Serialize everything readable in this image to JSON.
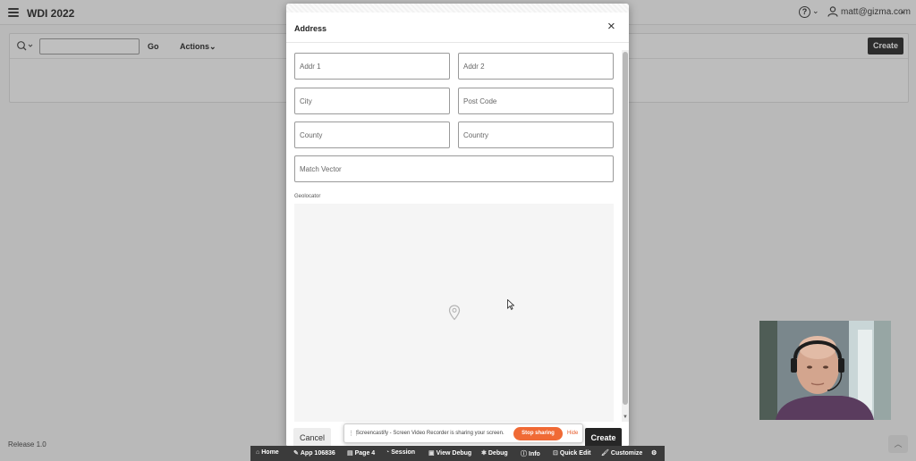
{
  "app": {
    "title": "WDI 2022",
    "user": "matt@gizma.com",
    "help_glyph": "?",
    "chevron_glyph": "⌄"
  },
  "toolbar": {
    "go_label": "Go",
    "actions_label": "Actions",
    "create_label": "Create"
  },
  "footer": {
    "release": "Release 1.0"
  },
  "dialog": {
    "title": "Address",
    "fields": {
      "addr1": "Addr 1",
      "addr2": "Addr 2",
      "city": "City",
      "post_code": "Post Code",
      "county": "County",
      "country": "Country",
      "match_vector": "Match Vector"
    },
    "geolocator_label": "Geolocator",
    "cancel_label": "Cancel",
    "create_label": "Create"
  },
  "share_bar": {
    "message": "Screencastify - Screen Video Recorder is sharing your screen.",
    "stop_label": "Stop sharing",
    "hide_label": "Hide"
  },
  "dev_toolbar": {
    "home": "Home",
    "app": "App 106836",
    "page": "Page 4",
    "session": "Session",
    "view_debug": "View Debug",
    "debug": "Debug",
    "info": "Info",
    "quick_edit": "Quick Edit",
    "customize": "Customize"
  },
  "colors": {
    "primary_button": "#262626",
    "stop_sharing": "#f06a35",
    "dev_toolbar": "#3b3b3b"
  }
}
